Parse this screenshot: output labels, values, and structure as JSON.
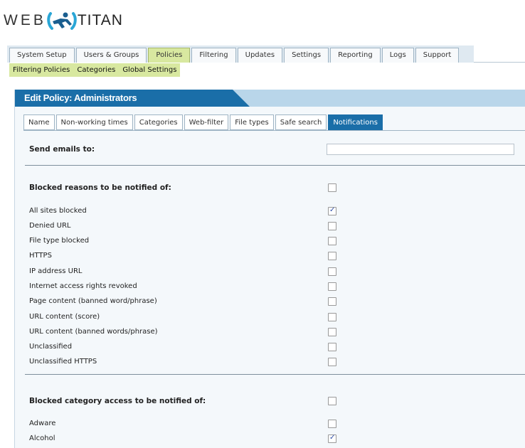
{
  "logo": {
    "left_text": "WEB",
    "right_text": "TITAN",
    "icon": "runner-icon"
  },
  "main_nav": {
    "tabs": [
      {
        "label": "System Setup"
      },
      {
        "label": "Users & Groups"
      },
      {
        "label": "Policies"
      },
      {
        "label": "Filtering"
      },
      {
        "label": "Updates"
      },
      {
        "label": "Settings"
      },
      {
        "label": "Reporting"
      },
      {
        "label": "Logs"
      },
      {
        "label": "Support"
      }
    ],
    "active": "Policies"
  },
  "sub_nav": {
    "items": [
      {
        "label": "Filtering Policies"
      },
      {
        "label": "Categories"
      },
      {
        "label": "Global Settings"
      }
    ]
  },
  "panel": {
    "title": "Edit Policy: Administrators"
  },
  "policy_tabs": {
    "tabs": [
      {
        "label": "Name"
      },
      {
        "label": "Non-working times"
      },
      {
        "label": "Categories"
      },
      {
        "label": "Web-filter"
      },
      {
        "label": "File types"
      },
      {
        "label": "Safe search"
      },
      {
        "label": "Notifications"
      }
    ],
    "active": "Notifications"
  },
  "form": {
    "send_emails_label": "Send emails to:",
    "send_emails_value": "",
    "blocked_reasons": {
      "heading": "Blocked reasons to be notified of:",
      "heading_checked": false,
      "items": [
        {
          "label": "All sites blocked",
          "checked": true
        },
        {
          "label": "Denied URL",
          "checked": false
        },
        {
          "label": "File type blocked",
          "checked": false
        },
        {
          "label": "HTTPS",
          "checked": false
        },
        {
          "label": "IP address URL",
          "checked": false
        },
        {
          "label": "Internet access rights revoked",
          "checked": false
        },
        {
          "label": "Page content (banned word/phrase)",
          "checked": false
        },
        {
          "label": "URL content (score)",
          "checked": false
        },
        {
          "label": "URL content (banned words/phrase)",
          "checked": false
        },
        {
          "label": "Unclassified",
          "checked": false
        },
        {
          "label": "Unclassified HTTPS",
          "checked": false
        }
      ]
    },
    "blocked_categories": {
      "heading": "Blocked category access to be notified of:",
      "heading_checked": false,
      "items": [
        {
          "label": "Adware",
          "checked": false
        },
        {
          "label": "Alcohol",
          "checked": true
        }
      ]
    }
  },
  "colors": {
    "brand_blue": "#1a6ea8",
    "active_green": "#d8e8a0",
    "checkbox_mark": "#2f4fa8"
  }
}
